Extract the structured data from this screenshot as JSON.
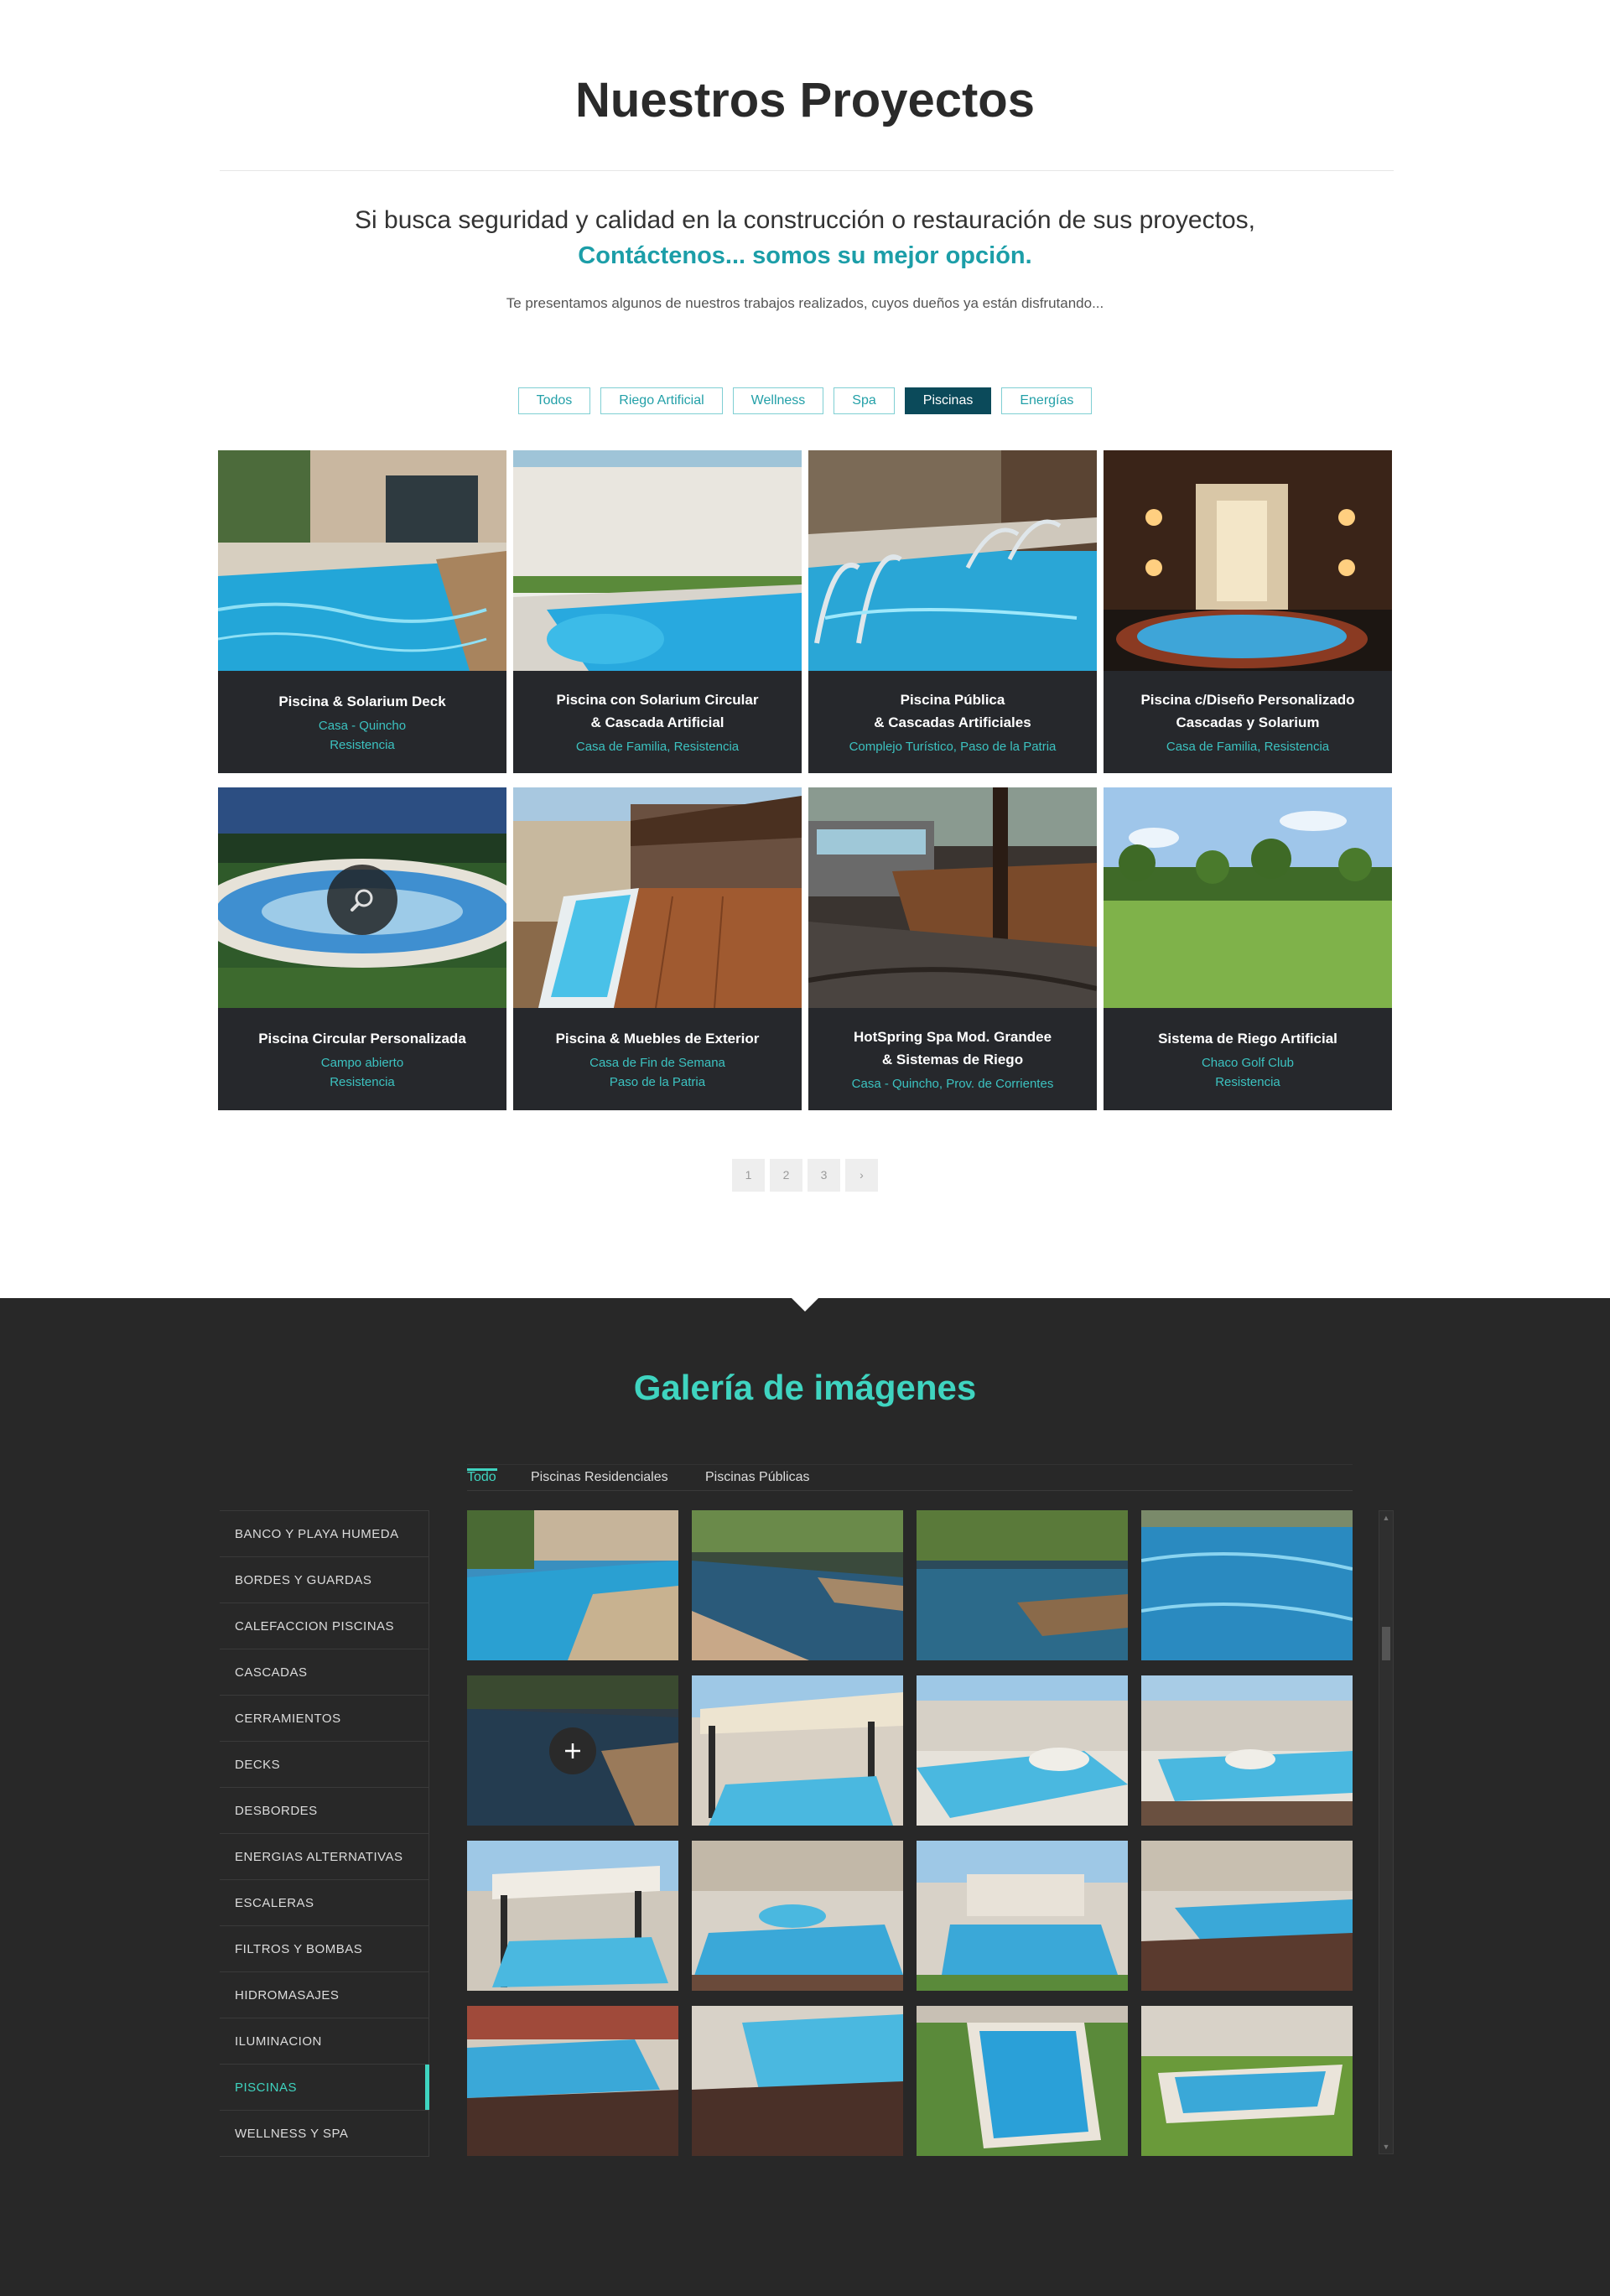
{
  "projects": {
    "title": "Nuestros Proyectos",
    "lead": "Si busca seguridad y calidad en la construcción o restauración de sus proyectos,",
    "lead_accent": "Contáctenos... somos su mejor opción.",
    "intro": "Te presentamos algunos de nuestros trabajos realizados, cuyos dueños ya están disfrutando...",
    "filters": [
      "Todos",
      "Riego Artificial",
      "Wellness",
      "Spa",
      "Piscinas",
      "Energías"
    ],
    "active_filter": "Piscinas",
    "cards": [
      {
        "title": "Piscina & Solarium Deck",
        "meta": "Casa - Quincho\nResistencia",
        "scene": "pool-house"
      },
      {
        "title": "Piscina con Solarium Circular\n& Cascada Artificial",
        "meta": "Casa de Familia, Resistencia",
        "scene": "pool-wall"
      },
      {
        "title": "Piscina Pública\n& Cascadas Artificiales",
        "meta": "Complejo Turístico, Paso de la Patria",
        "scene": "pool-rails"
      },
      {
        "title": "Piscina c/Diseño Personalizado\nCascadas y Solarium",
        "meta": "Casa de Familia, Resistencia",
        "scene": "pool-night"
      },
      {
        "title": "Piscina Circular Personalizada",
        "meta": "Campo abierto\nResistencia",
        "scene": "pool-circular"
      },
      {
        "title": "Piscina & Muebles de Exterior",
        "meta": "Casa de Fin de Semana\nPaso de la Patria",
        "scene": "pool-deck"
      },
      {
        "title": "HotSpring Spa Mod. Grandee\n& Sistemas de Riego",
        "meta": "Casa - Quincho, Prov. de Corrientes",
        "scene": "spa-deck"
      },
      {
        "title": "Sistema de Riego Artificial",
        "meta": "Chaco Golf Club\nResistencia",
        "scene": "golf"
      }
    ],
    "pagination": [
      "1",
      "2",
      "3",
      "›"
    ]
  },
  "gallery": {
    "title": "Galería de imágenes",
    "tabs": [
      "Todo",
      "Piscinas Residenciales",
      "Piscinas Públicas"
    ],
    "active_tab": "Todo",
    "categories": [
      "BANCO Y PLAYA HUMEDA",
      "BORDES Y GUARDAS",
      "CALEFACCION PISCINAS",
      "CASCADAS",
      "CERRAMIENTOS",
      "DECKS",
      "DESBORDES",
      "ENERGIAS ALTERNATIVAS",
      "ESCALERAS",
      "FILTROS Y BOMBAS",
      "HIDROMASAJES",
      "ILUMINACION",
      "PISCINAS",
      "WELLNESS Y SPA"
    ],
    "active_category": "PISCINAS",
    "images": [
      "pool-house",
      "pool-dark",
      "pool-dark",
      "pool-water",
      "pool-dark",
      "gazebo",
      "pool-white",
      "pool-white",
      "gazebo",
      "pool-white",
      "pool-white",
      "pool-deck-top",
      "pool-deck-top",
      "pool-deck-top",
      "pool-garden",
      "pool-garden"
    ]
  },
  "colors": {
    "accent": "#3fd4c0",
    "teal_text": "#1c9ea8",
    "active_filter_bg": "#0b4a5a",
    "card_bg": "#26282c",
    "gallery_bg": "#282828"
  }
}
